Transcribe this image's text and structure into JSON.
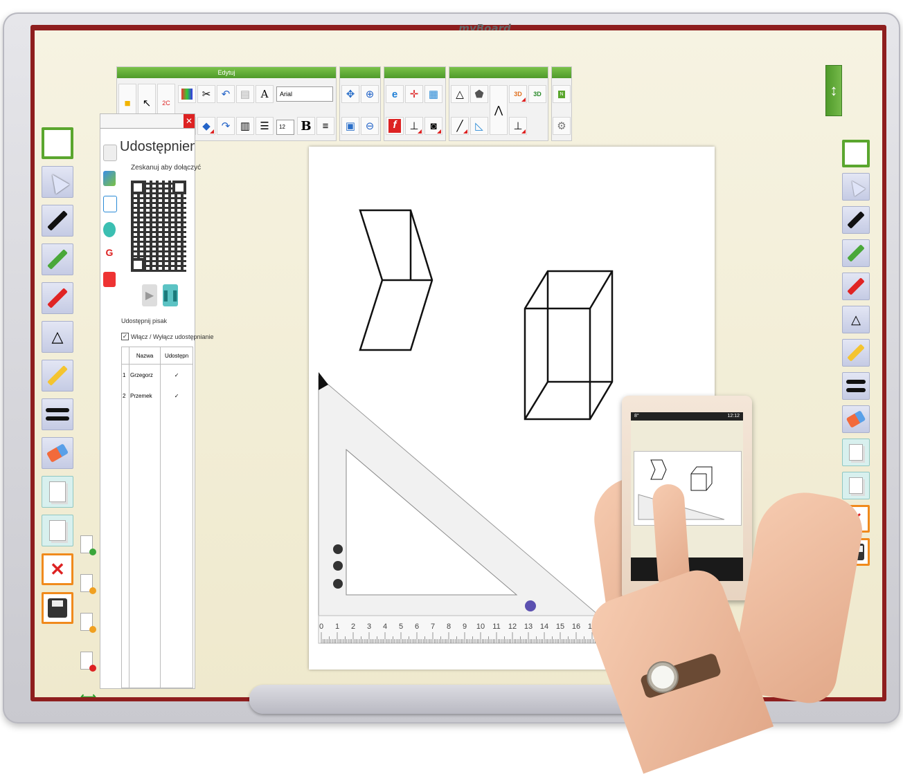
{
  "brand": {
    "name": "myBoard"
  },
  "toolbar": {
    "edit_group_label": "Edytuj",
    "font_name": "Arial",
    "font_size": "12",
    "bold_label": "B"
  },
  "share_panel": {
    "title": "Udostępnienie z u",
    "scan_prompt": "Zeskanuj aby dołączyć",
    "pen_share_label": "Udostępnij pisak",
    "toggle_label": "Włącz / Wyłącz udostępnianie",
    "toggle_checked": true,
    "table": {
      "headers": [
        "Nazwa",
        "Udostępn"
      ],
      "rows": [
        {
          "index": "1",
          "name": "Grzegorz",
          "shared": "✓"
        },
        {
          "index": "2",
          "name": "Przemek",
          "shared": "✓"
        }
      ]
    }
  },
  "ruler": {
    "tick_labels": [
      "0",
      "1",
      "2",
      "3",
      "4",
      "5",
      "6",
      "7",
      "8",
      "9",
      "10",
      "11",
      "12",
      "13",
      "14",
      "15",
      "16",
      "17"
    ]
  },
  "tablet": {
    "status_left": "8°",
    "status_time": "12:12"
  },
  "icons": {
    "left_column": [
      "new-page-icon",
      "select-arrow-icon",
      "black-pen-icon",
      "green-pen-icon",
      "red-pen-icon",
      "shapes-icon",
      "highlighter-icon",
      "line-width-icon",
      "eraser-icon",
      "page-copy-icon",
      "page-add-icon",
      "delete-page-icon",
      "save-icon"
    ],
    "right_column": [
      "new-page-icon",
      "select-arrow-icon",
      "black-pen-icon",
      "green-pen-icon",
      "red-pen-icon",
      "shapes-icon",
      "highlighter-icon",
      "line-width-icon",
      "eraser-icon",
      "page-copy-icon",
      "page-add-icon",
      "delete-page-icon",
      "save-icon"
    ]
  },
  "colors": {
    "accent_green": "#5aa62e",
    "frame_red": "#8e1e1e",
    "screen_bg": "#f3efd6",
    "delete_orange": "#f08a1c"
  }
}
